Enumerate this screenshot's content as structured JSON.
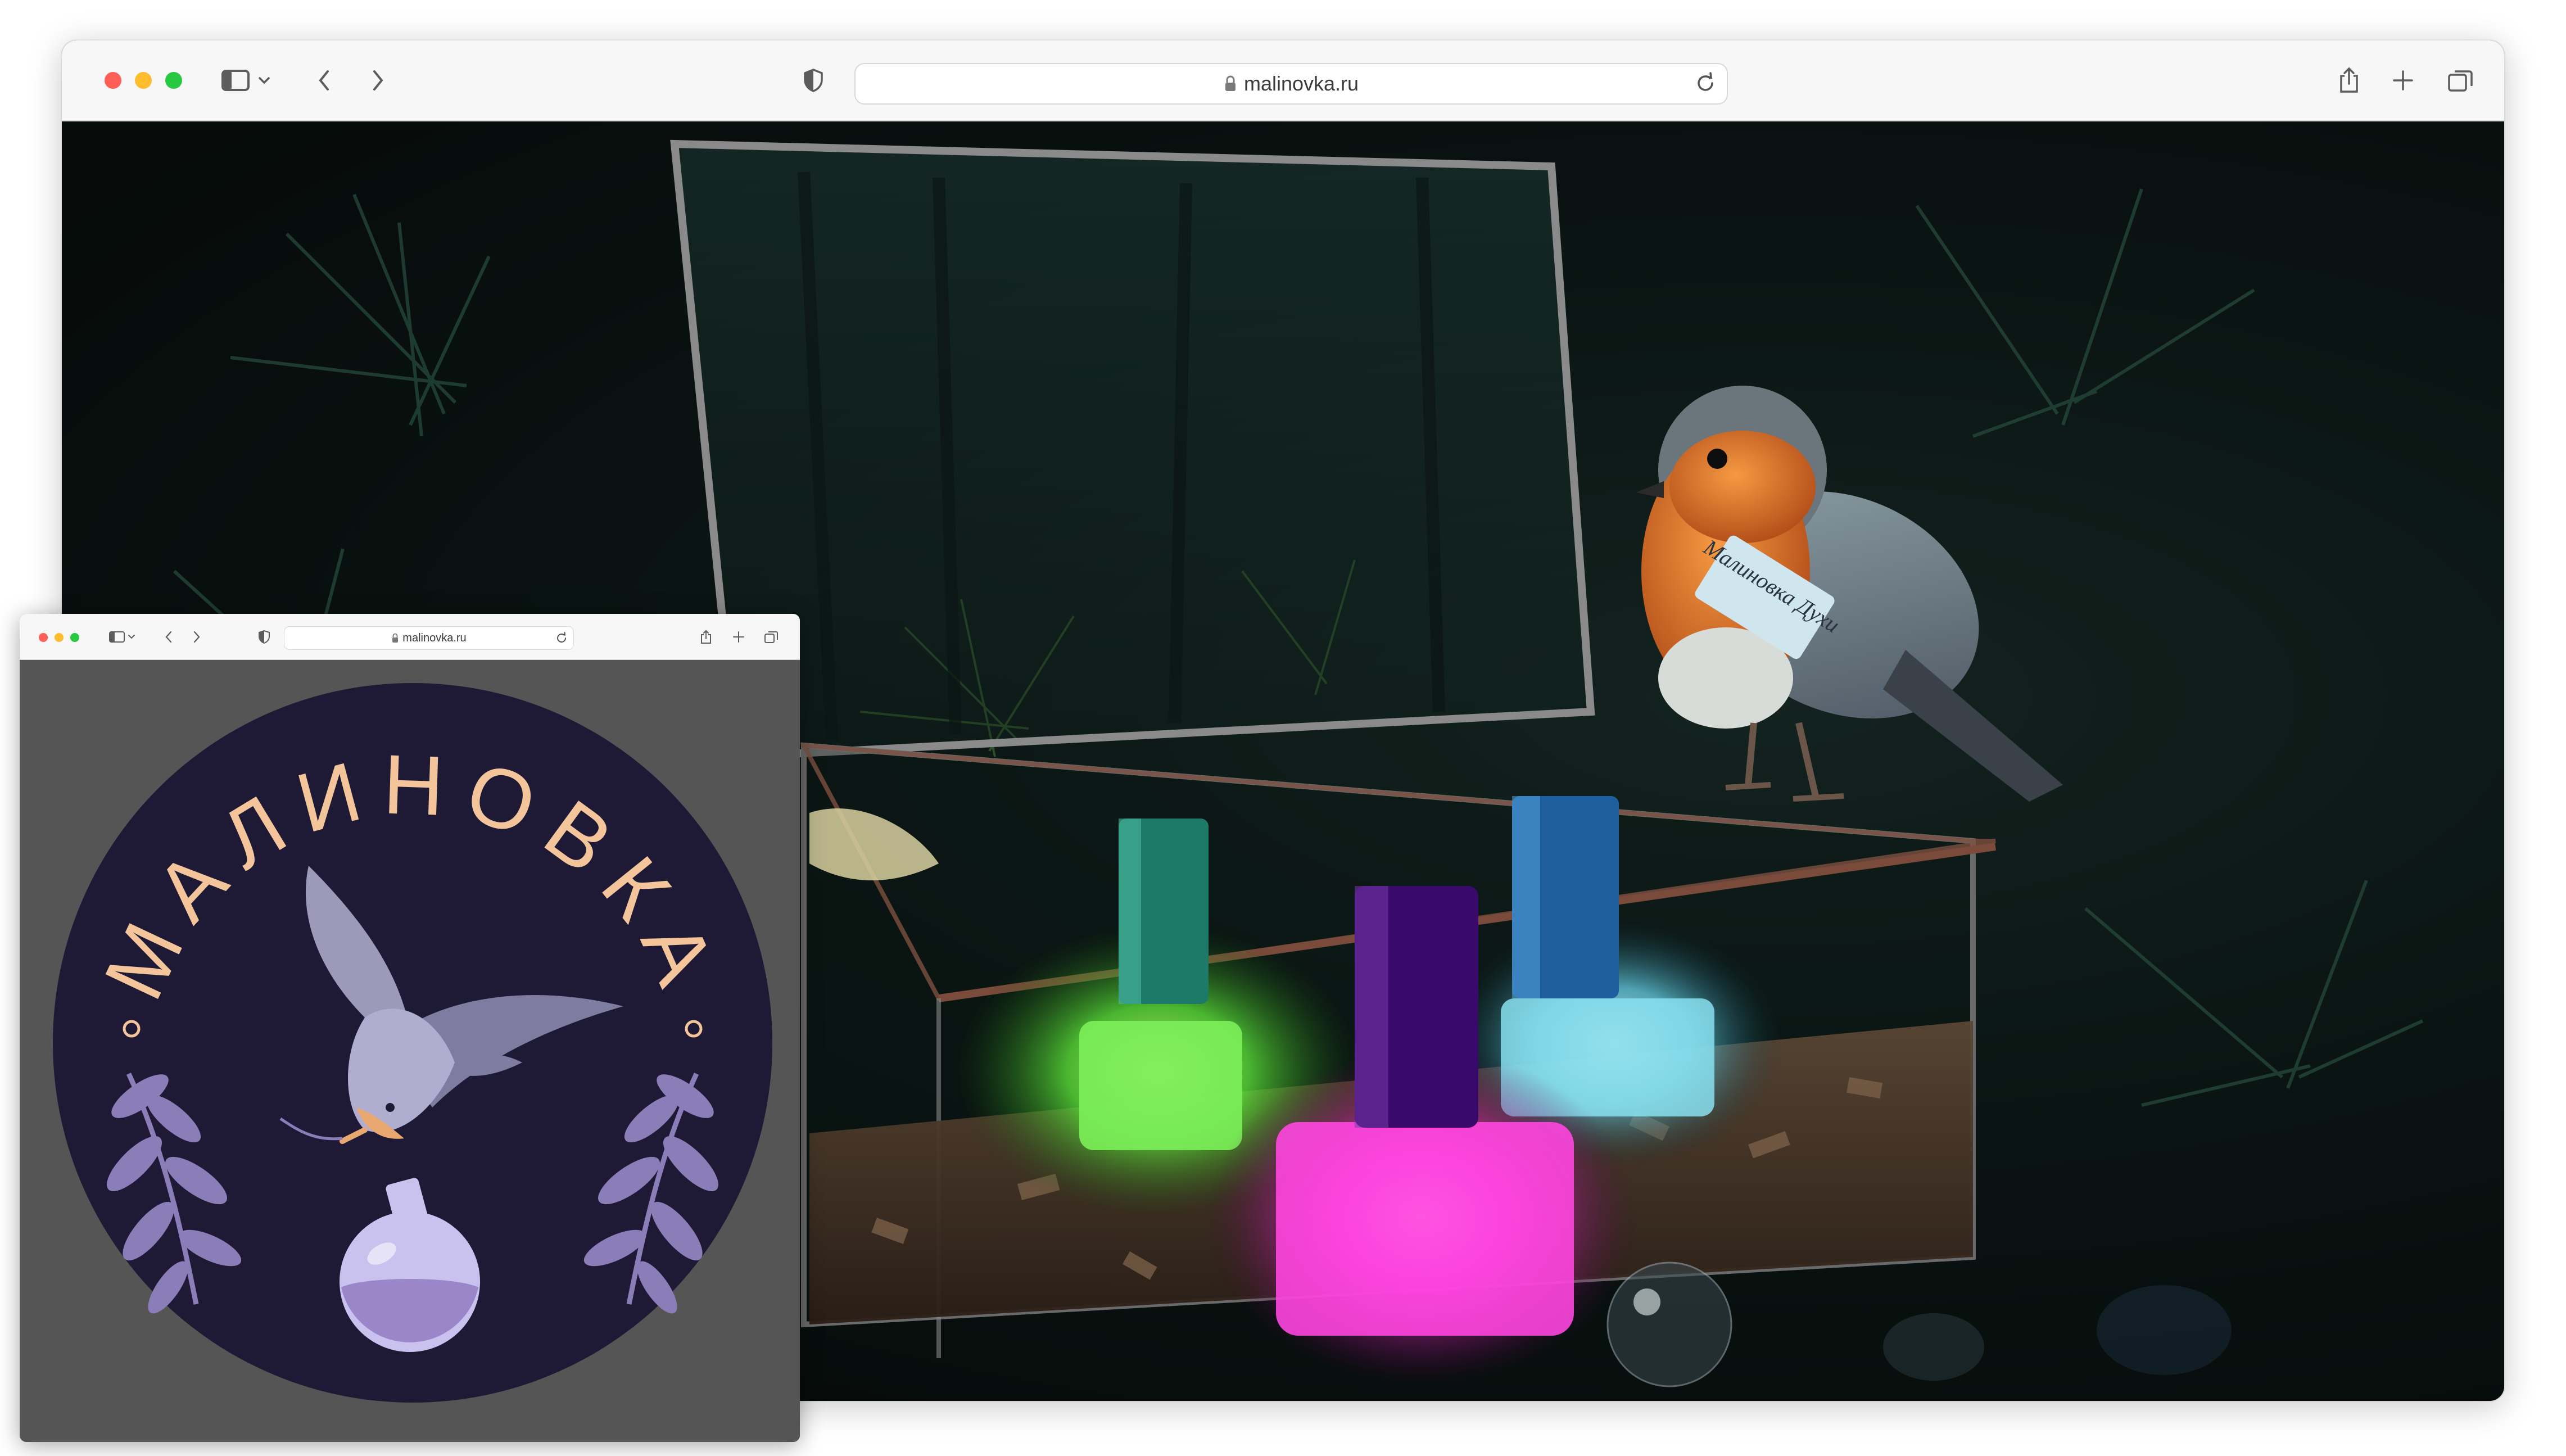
{
  "main_window": {
    "url": "malinovka.ru",
    "icons": {
      "sidebar": "sidebar-icon",
      "chevron": "chevron-down-icon",
      "back": "back-arrow-icon",
      "forward": "forward-arrow-icon",
      "privacy": "shield-icon",
      "lock": "lock-icon",
      "reload": "reload-icon",
      "share": "share-icon",
      "new_tab": "plus-icon",
      "tabs": "tabs-overview-icon"
    },
    "photo": {
      "tag_text": "Малиновка Духи"
    }
  },
  "small_window": {
    "url": "malinovka.ru",
    "logo": {
      "brand_name": "МАЛИНОВКА",
      "colors": {
        "circle": "#1e1a35",
        "text": "#f4c59a",
        "leaves": "#8a7db8",
        "bird": "#9c9ab8",
        "flask": "#a99ee0",
        "background": "#555555"
      }
    }
  },
  "colors": {
    "toolbar": "#f7f7f7",
    "traffic_red": "#ff5f57",
    "traffic_yellow": "#febc2e",
    "traffic_green": "#28c840"
  }
}
